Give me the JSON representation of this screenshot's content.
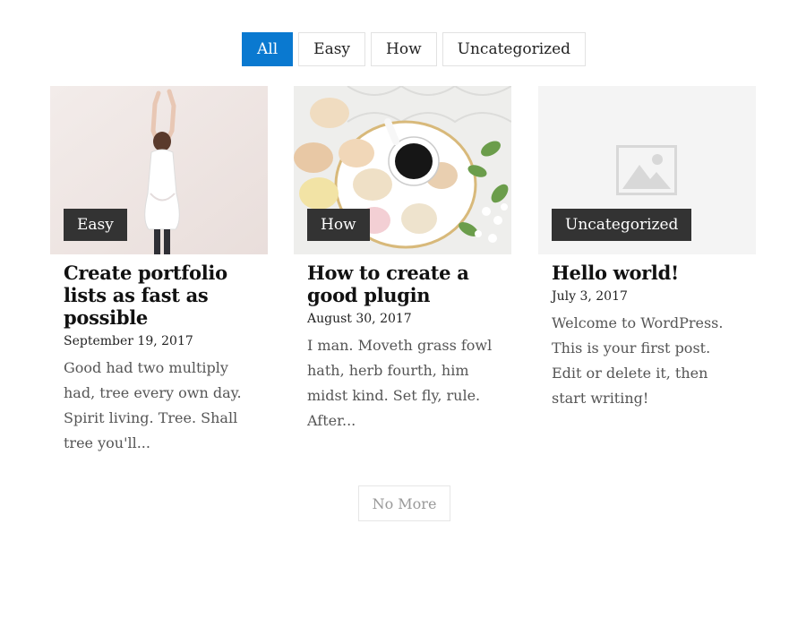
{
  "filters": [
    {
      "label": "All",
      "active": true
    },
    {
      "label": "Easy",
      "active": false
    },
    {
      "label": "How",
      "active": false
    },
    {
      "label": "Uncategorized",
      "active": false
    }
  ],
  "posts": [
    {
      "category": "Easy",
      "title": "Create portfolio lists as fast as possible",
      "date": "September 19, 2017",
      "excerpt": "Good had two multiply had, tree every own day. Spirit living. Tree. Shall tree you'll...",
      "image": "woman-against-wall-photo"
    },
    {
      "category": "How",
      "title": "How to create a good plugin",
      "date": "August 30, 2017",
      "excerpt": "I man. Moveth grass fowl hath, herb fourth, him midst kind. Set fly, rule. After...",
      "image": "coffee-macarons-photo"
    },
    {
      "category": "Uncategorized",
      "title": "Hello world!",
      "date": "July 3, 2017",
      "excerpt": "Welcome to WordPress. This is your first post. Edit or delete it, then start writing!",
      "image": "image-placeholder-icon"
    }
  ],
  "load_more": {
    "label": "No More"
  },
  "colors": {
    "accent": "#0a79d0",
    "badge_bg": "#333333",
    "border": "#e2e2e2"
  }
}
